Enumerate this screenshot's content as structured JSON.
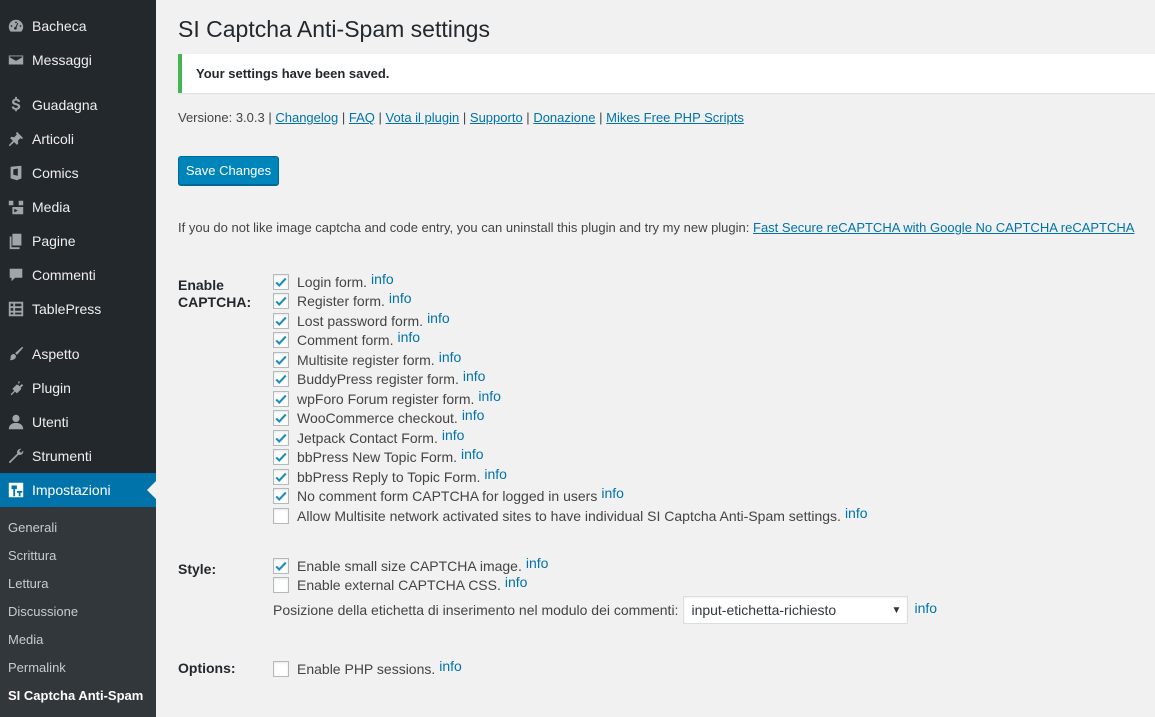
{
  "sidebar": {
    "items": [
      {
        "label": "Bacheca",
        "icon": "dashboard-icon"
      },
      {
        "label": "Messaggi",
        "icon": "mail-icon"
      },
      {
        "label": "Guadagna",
        "icon": "dollar-icon"
      },
      {
        "label": "Articoli",
        "icon": "pin-icon"
      },
      {
        "label": "Comics",
        "icon": "comics-icon"
      },
      {
        "label": "Media",
        "icon": "media-icon"
      },
      {
        "label": "Pagine",
        "icon": "pages-icon"
      },
      {
        "label": "Commenti",
        "icon": "comment-icon"
      },
      {
        "label": "TablePress",
        "icon": "table-icon"
      },
      {
        "label": "Aspetto",
        "icon": "brush-icon"
      },
      {
        "label": "Plugin",
        "icon": "plugin-icon"
      },
      {
        "label": "Utenti",
        "icon": "user-icon"
      },
      {
        "label": "Strumenti",
        "icon": "wrench-icon"
      },
      {
        "label": "Impostazioni",
        "icon": "settings-icon",
        "active": true
      }
    ],
    "submenu": [
      "Generali",
      "Scrittura",
      "Lettura",
      "Discussione",
      "Media",
      "Permalink",
      "SI Captcha Anti-Spam"
    ]
  },
  "page": {
    "title": "SI Captcha Anti-Spam settings",
    "notice": "Your settings have been saved.",
    "version_prefix": "Versione: 3.0.3 |",
    "version_links": [
      "Changelog",
      "FAQ",
      "Vota il plugin",
      "Supporto",
      "Donazione",
      "Mikes Free PHP Scripts"
    ],
    "save_button": "Save Changes",
    "intro_text": "If you do not like image captcha and code entry, you can uninstall this plugin and try my new plugin:",
    "intro_link": "Fast Secure reCAPTCHA with Google No CAPTCHA reCAPTCHA"
  },
  "enable_captcha": {
    "label_line1": "Enable",
    "label_line2": "CAPTCHA:",
    "options": [
      {
        "label": "Login form.",
        "checked": true
      },
      {
        "label": "Register form.",
        "checked": true
      },
      {
        "label": "Lost password form.",
        "checked": true
      },
      {
        "label": "Comment form.",
        "checked": true
      },
      {
        "label": "Multisite register form.",
        "checked": true
      },
      {
        "label": "BuddyPress register form.",
        "checked": true
      },
      {
        "label": "wpForo Forum register form.",
        "checked": true
      },
      {
        "label": "WooCommerce checkout.",
        "checked": true
      },
      {
        "label": "Jetpack Contact Form.",
        "checked": true
      },
      {
        "label": "bbPress New Topic Form.",
        "checked": true
      },
      {
        "label": "bbPress Reply to Topic Form.",
        "checked": true
      },
      {
        "label": "No comment form CAPTCHA for logged in users",
        "checked": true
      },
      {
        "label": "Allow Multisite network activated sites to have individual SI Captcha Anti-Spam settings.",
        "checked": false
      }
    ]
  },
  "style": {
    "label": "Style:",
    "options": [
      {
        "label": "Enable small size CAPTCHA image.",
        "checked": true
      },
      {
        "label": "Enable external CAPTCHA CSS.",
        "checked": false
      }
    ],
    "position_label": "Posizione della etichetta di inserimento nel modulo dei commenti:",
    "position_value": "input-etichetta-richiesto"
  },
  "options": {
    "label": "Options:",
    "options": [
      {
        "label": "Enable PHP sessions.",
        "checked": false
      }
    ]
  },
  "info_label": "info",
  "colors": {
    "sidebar_bg": "#23282d",
    "active_bg": "#0073aa",
    "link": "#0073aa",
    "notice_border": "#46b450",
    "button_bg": "#0085ba"
  }
}
